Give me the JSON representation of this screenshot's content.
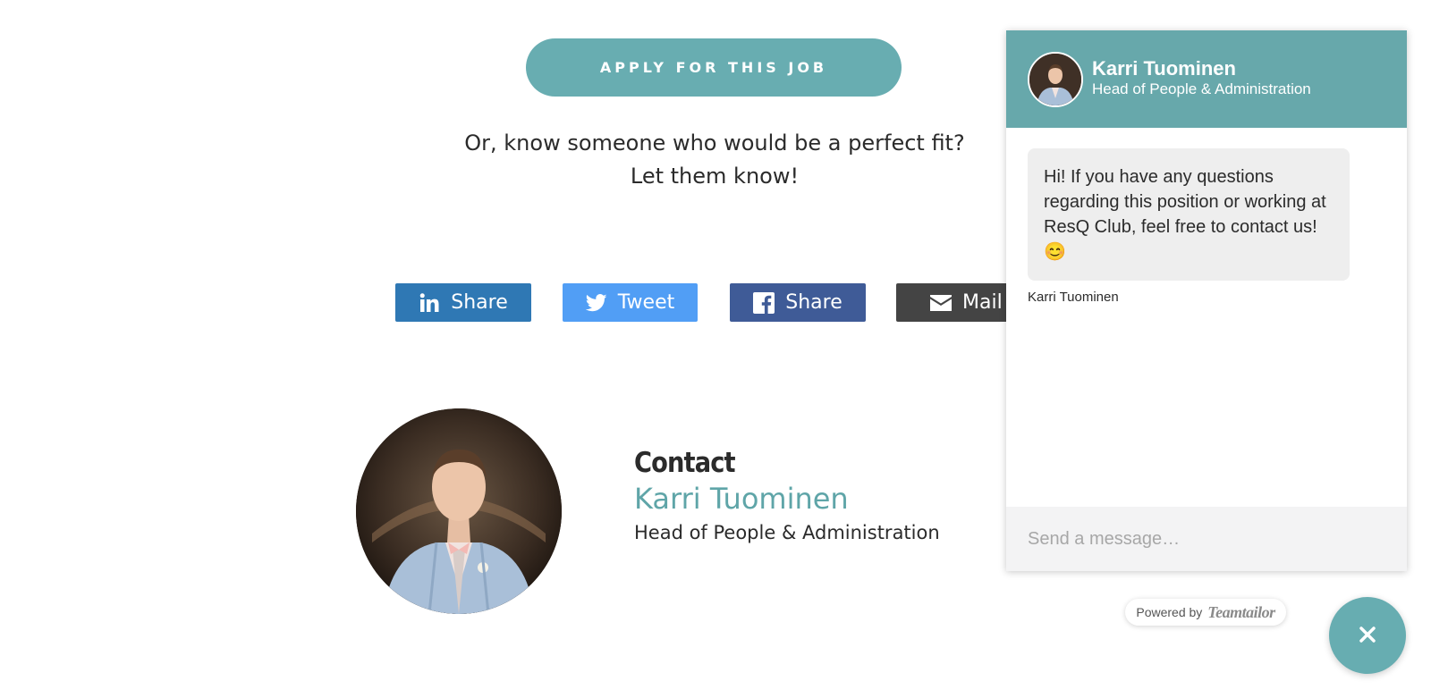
{
  "colors": {
    "accent": "#68adb1",
    "linkedin": "#2f78b4",
    "twitter": "#519ef5",
    "facebook": "#3f5b97",
    "mail": "#444444",
    "chat_header": "#67a8ab"
  },
  "apply": {
    "label": "APPLY FOR THIS JOB"
  },
  "refer": {
    "line1": "Or, know someone who would be a perfect fit?",
    "line2": "Let them know!"
  },
  "share_buttons": [
    {
      "label": "Share",
      "icon": "linkedin-icon"
    },
    {
      "label": "Tweet",
      "icon": "twitter-icon"
    },
    {
      "label": "Share",
      "icon": "facebook-icon"
    },
    {
      "label": "Mail",
      "icon": "mail-icon"
    }
  ],
  "contact": {
    "heading": "Contact",
    "name": "Karri Tuominen",
    "role": "Head of People & Administration"
  },
  "chat": {
    "header_name": "Karri Tuominen",
    "header_title": "Head of People & Administration",
    "message": "Hi! If you have any questions regarding this position or working at ResQ Club, feel free to contact us! 😊",
    "sender": "Karri Tuominen",
    "input_placeholder": "Send a message…"
  },
  "powered_by": {
    "label": "Powered by",
    "brand": "Teamtailor"
  },
  "close_fab": {
    "icon": "close-icon"
  }
}
